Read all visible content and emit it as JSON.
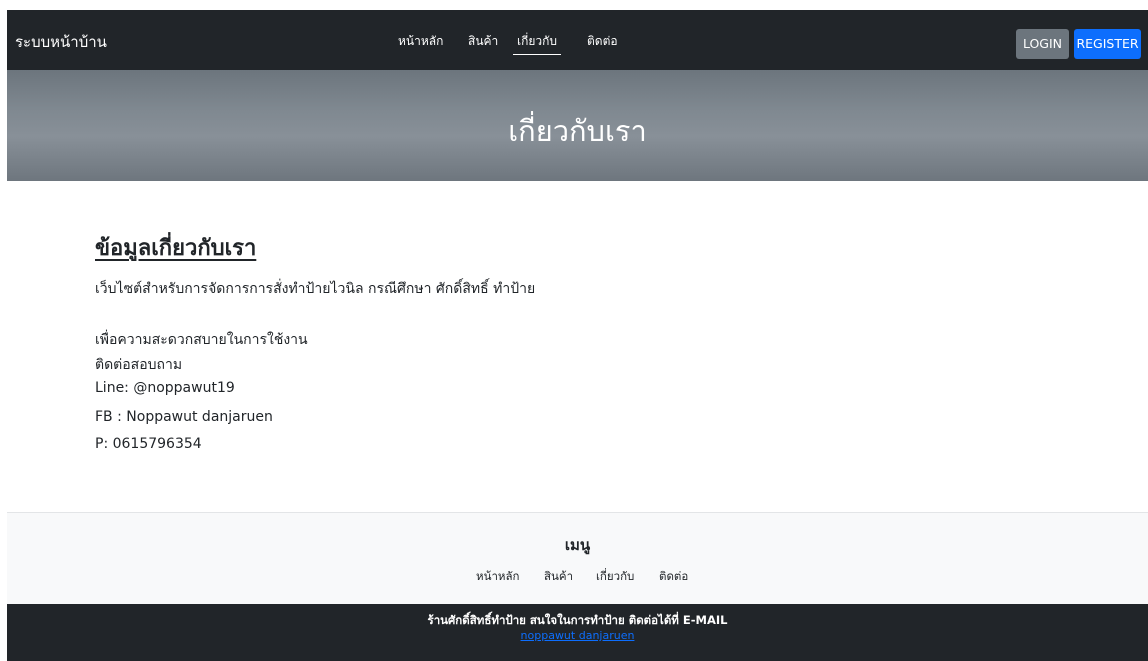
{
  "navbar": {
    "brand": "ระบบหน้าบ้าน",
    "links": [
      "หน้าหลัก",
      "สินค้า",
      "เกี่ยวกับ",
      "ติดต่อ"
    ],
    "active_link": "เกี่ยวกับ",
    "login_label": "LOGIN",
    "register_label": "REGISTER"
  },
  "hero": {
    "title": "เกี่ยวกับเรา"
  },
  "about": {
    "heading": "ข้อมูลเกี่ยวกับเรา",
    "description": "เว็บไซต์สำหรับการจัดการการสั่งทำป้ายไวนิล กรณีศึกษา ศักดิ์สิทธิ์ ทำป้าย",
    "lines": [
      "เพื่อความสะดวกสบายในการใช้งาน",
      "ติดต่อสอบถาม",
      "Line: @noppawut19",
      "FB : Noppawut danjaruen",
      "P: 0615796354"
    ]
  },
  "footer": {
    "menu_title": "เมนู",
    "links": [
      "หน้าหลัก",
      "สินค้า",
      "เกี่ยวกับ",
      "ติดต่อ"
    ],
    "shop_text": "ร้านศักดิ์สิทธิ์ทำป้าย สนใจในการทำป้าย ติดต่อได้ที่ E-MAIL",
    "email_link": "noppawut danjaruen"
  },
  "colors": {
    "navbar_bg": "#212529",
    "login_bg": "#6c757d",
    "register_bg": "#0d6efd",
    "hero_gradient_mid": "#889098",
    "footer_menu_bg": "#f8f9fa",
    "link_blue": "#0d6efd"
  }
}
